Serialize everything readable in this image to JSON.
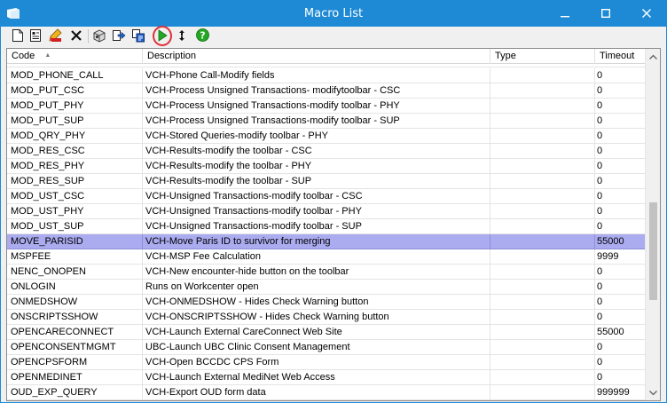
{
  "window": {
    "title": "Macro List",
    "minimize_icon": "minimize-icon",
    "maximize_icon": "maximize-icon",
    "close_icon": "close-icon"
  },
  "toolbar": {
    "buttons": [
      {
        "name": "new-document-icon"
      },
      {
        "name": "properties-icon"
      },
      {
        "name": "edit-icon"
      },
      {
        "name": "delete-icon"
      },
      {
        "name": "export-package-icon"
      },
      {
        "name": "import-icon"
      },
      {
        "name": "copy-icon"
      },
      {
        "name": "run-icon"
      },
      {
        "name": "refresh-icon"
      },
      {
        "name": "help-icon"
      }
    ],
    "accent_run": "#22a822",
    "highlight_color": "#e0303a"
  },
  "grid": {
    "columns": [
      {
        "label": "Code",
        "sorted": "ascending"
      },
      {
        "label": "Description"
      },
      {
        "label": "Type"
      },
      {
        "label": "Timeout"
      }
    ],
    "selected_color": "#ababf0",
    "rows": [
      {
        "code": "MOD_PHONE_CALL",
        "description": "VCH-Phone Call-Modify fields",
        "type": "",
        "timeout": "0"
      },
      {
        "code": "MOD_PUT_CSC",
        "description": "VCH-Process Unsigned Transactions- modifytoolbar - CSC",
        "type": "",
        "timeout": "0"
      },
      {
        "code": "MOD_PUT_PHY",
        "description": "VCH-Process Unsigned Transactions-modify toolbar - PHY",
        "type": "",
        "timeout": "0"
      },
      {
        "code": "MOD_PUT_SUP",
        "description": "VCH-Process Unsigned Transactions-modify toolbar - SUP",
        "type": "",
        "timeout": "0"
      },
      {
        "code": "MOD_QRY_PHY",
        "description": "VCH-Stored Queries-modify toolbar - PHY",
        "type": "",
        "timeout": "0"
      },
      {
        "code": "MOD_RES_CSC",
        "description": "VCH-Results-modify the toolbar - CSC",
        "type": "",
        "timeout": "0"
      },
      {
        "code": "MOD_RES_PHY",
        "description": "VCH-Results-modify the toolbar - PHY",
        "type": "",
        "timeout": "0"
      },
      {
        "code": "MOD_RES_SUP",
        "description": "VCH-Results-modify the toolbar - SUP",
        "type": "",
        "timeout": "0"
      },
      {
        "code": "MOD_UST_CSC",
        "description": "VCH-Unsigned Transactions-modify toolbar - CSC",
        "type": "",
        "timeout": "0"
      },
      {
        "code": "MOD_UST_PHY",
        "description": "VCH-Unsigned Transactions-modify toolbar - PHY",
        "type": "",
        "timeout": "0"
      },
      {
        "code": "MOD_UST_SUP",
        "description": "VCH-Unsigned Transactions-modify toolbar - SUP",
        "type": "",
        "timeout": "0"
      },
      {
        "code": "MOVE_PARISID",
        "description": "VCH-Move Paris ID to survivor for merging",
        "type": "",
        "timeout": "55000",
        "selected": true
      },
      {
        "code": "MSPFEE",
        "description": "VCH-MSP Fee Calculation",
        "type": "",
        "timeout": "9999"
      },
      {
        "code": "NENC_ONOPEN",
        "description": "VCH-New encounter-hide button on the toolbar",
        "type": "",
        "timeout": "0"
      },
      {
        "code": "ONLOGIN",
        "description": "Runs on Workcenter open",
        "type": "",
        "timeout": "0"
      },
      {
        "code": "ONMEDSHOW",
        "description": "VCH-ONMEDSHOW - Hides Check Warning button",
        "type": "",
        "timeout": "0"
      },
      {
        "code": "ONSCRIPTSSHOW",
        "description": "VCH-ONSCRIPTSSHOW - Hides Check Warning button",
        "type": "",
        "timeout": "0"
      },
      {
        "code": "OPENCARECONNECT",
        "description": "VCH-Launch External CareConnect Web Site",
        "type": "",
        "timeout": "55000"
      },
      {
        "code": "OPENCONSENTMGMT",
        "description": "UBC-Launch UBC Clinic Consent Management",
        "type": "",
        "timeout": "0"
      },
      {
        "code": "OPENCPSFORM",
        "description": "VCH-Open BCCDC CPS Form",
        "type": "",
        "timeout": "0"
      },
      {
        "code": "OPENMEDINET",
        "description": "VCH-Launch External MediNet Web Access",
        "type": "",
        "timeout": "0"
      },
      {
        "code": "OUD_EXP_QUERY",
        "description": "VCH-Export OUD form data",
        "type": "",
        "timeout": "999999"
      }
    ]
  },
  "scrollbar": {
    "position": 0.62
  }
}
